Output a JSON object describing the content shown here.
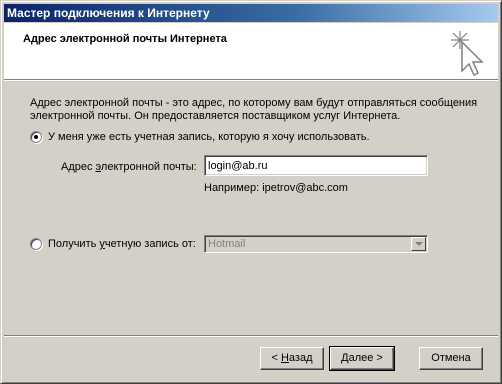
{
  "window": {
    "title": "Мастер подключения к Интернету"
  },
  "header": {
    "title": "Адрес электронной почты Интернета",
    "icon": "wizard-sparkle-cursor-icon"
  },
  "description": {
    "line1": "Адрес электронной почты - это адрес, по которому вам будут отправляться сообщения",
    "line2": "электронной почты. Он предоставляется поставщиком услуг Интернета."
  },
  "option_existing": {
    "label": "У меня уже есть учетная запись, которую я хочу использовать.",
    "checked": true
  },
  "email_field": {
    "label_before": "Адрес ",
    "label_accel": "э",
    "label_after": "лектронной почты:",
    "value": "login@ab.ru",
    "example": "Например: ipetrov@abc.com"
  },
  "option_get_account": {
    "label_before": "Получить ",
    "label_accel": "у",
    "label_after": "четную запись от:",
    "checked": false,
    "select_value": "Hotmail"
  },
  "buttons": {
    "back_prefix": "< ",
    "back_accel": "Н",
    "back_rest": "азад",
    "next": "Далее >",
    "cancel": "Отмена"
  }
}
